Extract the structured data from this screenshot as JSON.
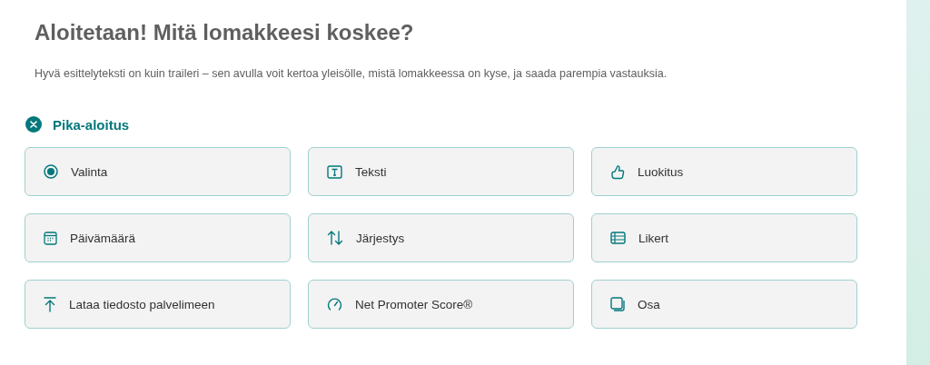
{
  "heading": "Aloitetaan! Mitä lomakkeesi koskee?",
  "description": "Hyvä esittelyteksti on kuin traileri – sen avulla voit kertoa yleisölle, mistä lomakkeessa on kyse, ja saada parempia vastauksia.",
  "quick_start": {
    "label": "Pika-aloitus",
    "expanded": true
  },
  "options": [
    {
      "kind": "choice",
      "label": "Valinta"
    },
    {
      "kind": "text",
      "label": "Teksti"
    },
    {
      "kind": "rating",
      "label": "Luokitus"
    },
    {
      "kind": "date",
      "label": "Päivämäärä"
    },
    {
      "kind": "ranking",
      "label": "Järjestys"
    },
    {
      "kind": "likert",
      "label": "Likert"
    },
    {
      "kind": "upload",
      "label": "Lataa tiedosto palvelimeen"
    },
    {
      "kind": "nps",
      "label": "Net Promoter Score®"
    },
    {
      "kind": "section",
      "label": "Osa"
    }
  ]
}
